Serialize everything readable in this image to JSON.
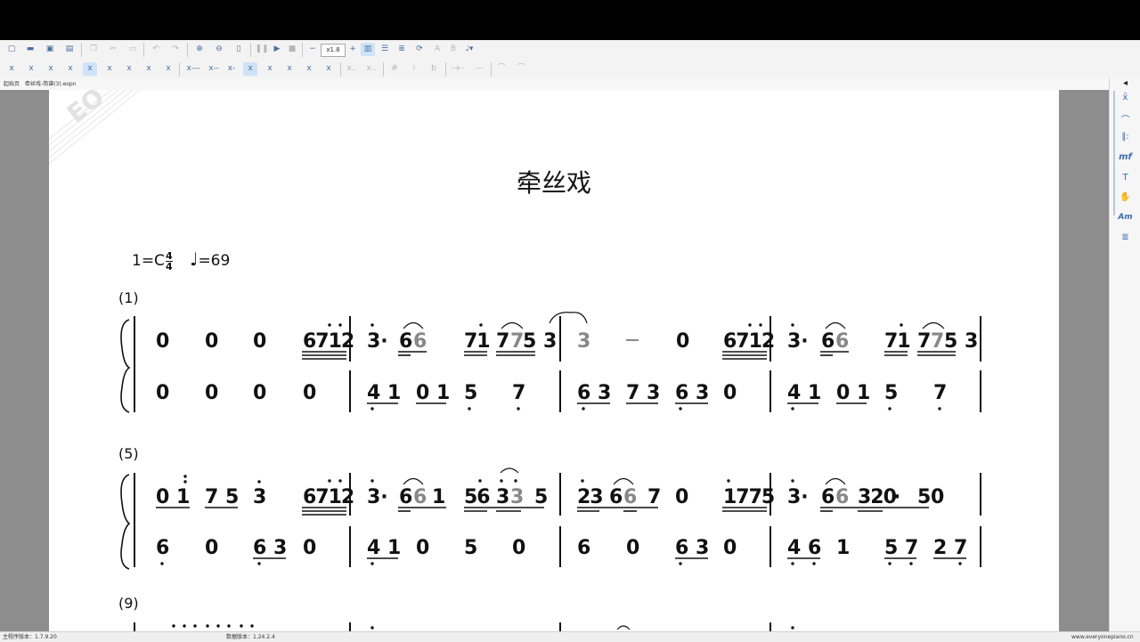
{
  "toolbar": {
    "zoom": "x1.8",
    "row1_icons": [
      "new-file-icon",
      "open-folder-icon",
      "save-icon",
      "print-icon",
      "copy-icon",
      "cut-icon",
      "paste-icon",
      "undo-icon",
      "redo-icon",
      "zoom-in-icon",
      "zoom-out-icon",
      "fit-page-icon",
      "pause-icon",
      "play-icon",
      "stop-icon",
      "minus-icon",
      "plus-icon",
      "layout-icon",
      "rows-icon",
      "staff-icon",
      "refresh-icon",
      "letter-a-icon",
      "letter-b-icon",
      "metronome-icon"
    ],
    "row2_labels": [
      "x",
      "x",
      "x",
      "x",
      "x",
      "x",
      "x",
      "x",
      "x",
      "x---",
      "x--",
      "x-",
      "x",
      "x",
      "x",
      "x",
      "x",
      "x..",
      "x..",
      "#",
      "♮",
      "b",
      "-+-",
      "---",
      "⌒",
      "⌒"
    ]
  },
  "tab": {
    "home_label": "起始页",
    "file_label": "牵丝戏-简谱(3).eopn"
  },
  "watermark": "EO",
  "score": {
    "title": "牵丝戏",
    "key": "1=C",
    "time_top": "4",
    "time_bottom": "4",
    "tempo": "=69",
    "systems": [
      {
        "number": "(1)"
      },
      {
        "number": "(5)"
      },
      {
        "number": "(9)"
      }
    ]
  },
  "right_panel": {
    "icons": [
      "arrow-left-icon",
      "note-icon",
      "fermata-icon",
      "repeat-icon",
      "dynamics-icon",
      "text-icon",
      "hand-icon",
      "chord-icon",
      "indent-icon"
    ],
    "dynamics_label": "mf",
    "text_label": "T",
    "chord_label": "Am"
  },
  "status": {
    "program_version": "主程序版本：1.7.9.20",
    "data_version": "数据版本：1.24.2.4",
    "website": "www.everyonepiano.cn"
  }
}
